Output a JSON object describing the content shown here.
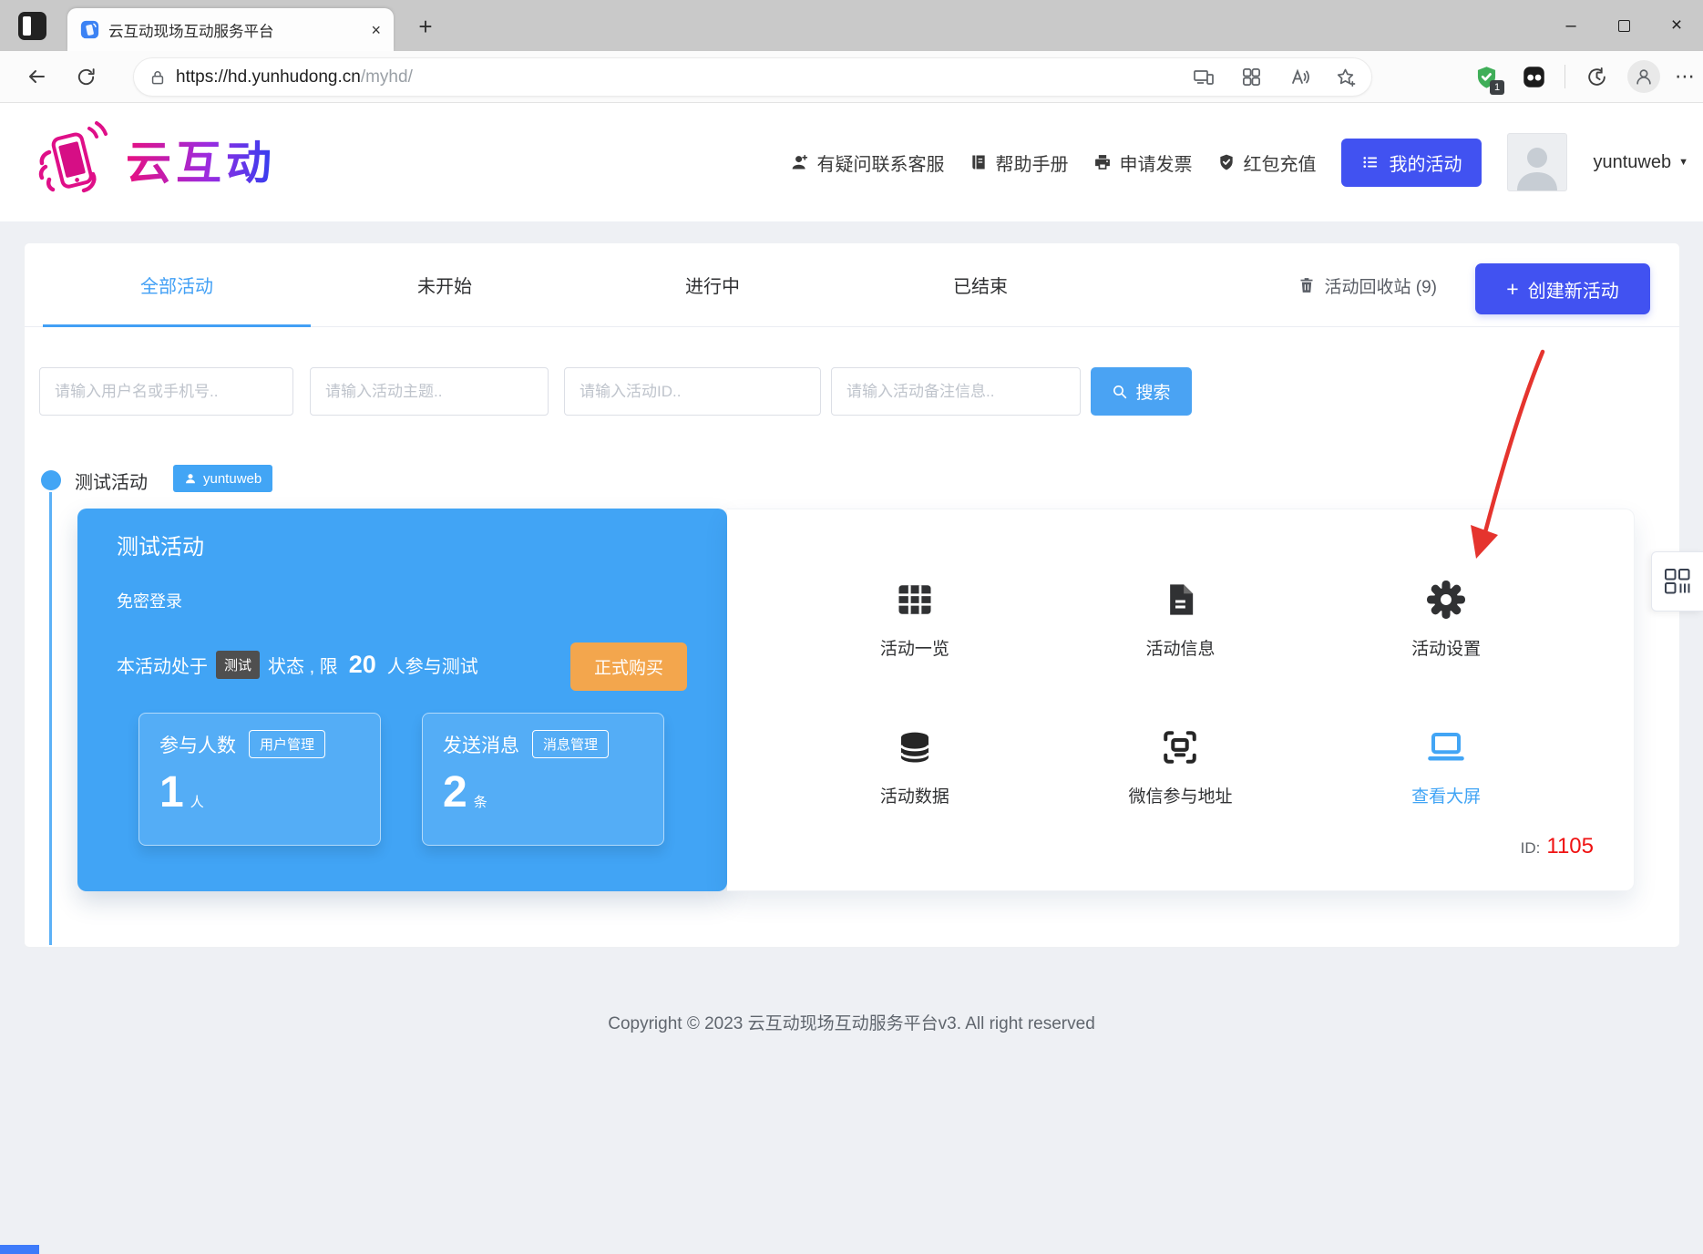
{
  "browser": {
    "tab_title": "云互动现场互动服务平台",
    "url_host": "https://hd.yunhudong.cn",
    "url_path": "/myhd/",
    "shield_badge": "1"
  },
  "glyphs": {
    "new_tab": "+",
    "close": "×",
    "minimize": "–",
    "ellipsis": "⋯",
    "caret": "▼",
    "plus": "+"
  },
  "logo": {
    "text": "云互动"
  },
  "header": {
    "nav": [
      {
        "label": "有疑问联系客服"
      },
      {
        "label": "帮助手册"
      },
      {
        "label": "申请发票"
      },
      {
        "label": "红包充值"
      }
    ],
    "my_activities": "我的活动",
    "username": "yuntuweb"
  },
  "tabs": [
    {
      "label": "全部活动",
      "active": true
    },
    {
      "label": "未开始",
      "active": false
    },
    {
      "label": "进行中",
      "active": false
    },
    {
      "label": "已结束",
      "active": false
    }
  ],
  "toolbar_actions": {
    "recycle": "活动回收站 (9)",
    "create": "创建新活动"
  },
  "search": {
    "placeholders": [
      "请输入用户名或手机号..",
      "请输入活动主题..",
      "请输入活动ID..",
      "请输入活动备注信息.."
    ],
    "button": "搜索"
  },
  "activity": {
    "title": "测试活动",
    "owner": "yuntuweb",
    "card": {
      "title": "测试活动",
      "subtitle": "免密登录",
      "status_prefix": "本活动处于",
      "status_badge": "测试",
      "status_mid": "状态 , 限",
      "limit": "20",
      "status_suffix": "人参与测试",
      "buy_button": "正式购买",
      "stats": [
        {
          "label": "参与人数",
          "manage": "用户管理",
          "value": "1",
          "unit": "人"
        },
        {
          "label": "发送消息",
          "manage": "消息管理",
          "value": "2",
          "unit": "条"
        }
      ]
    },
    "actions": [
      {
        "label": "活动一览"
      },
      {
        "label": "活动信息"
      },
      {
        "label": "活动设置"
      },
      {
        "label": "活动数据"
      },
      {
        "label": "微信参与地址"
      },
      {
        "label": "查看大屏"
      }
    ],
    "id_label": "ID:",
    "id_value": "1105"
  },
  "footer": {
    "copyright": "Copyright © 2023 云互动现场互动服务平台v3. All right reserved"
  },
  "colors": {
    "primary_indigo": "#4152f1",
    "light_blue": "#42a5f5",
    "search_blue": "#4aa3f3",
    "orange": "#f3a64d",
    "id_red": "#ef1212",
    "arrow_red": "#e5342e",
    "shield_green": "#3fae58",
    "page_bg": "#eef0f4"
  }
}
